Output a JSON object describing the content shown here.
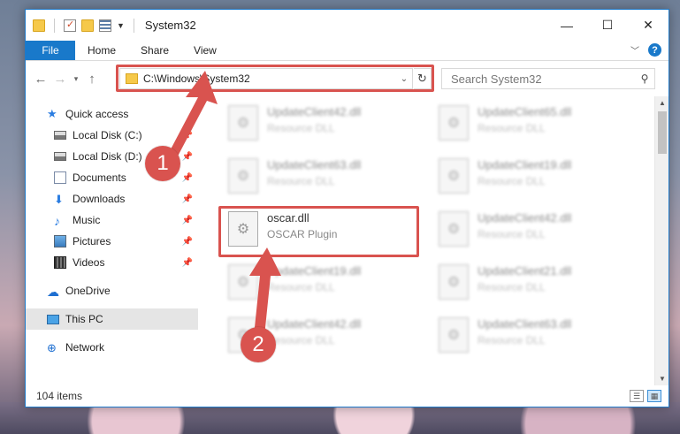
{
  "titlebar": {
    "title": "System32",
    "controls": {
      "minimize": "—",
      "maximize": "☐",
      "close": "✕"
    }
  },
  "ribbon": {
    "tabs": [
      "File",
      "Home",
      "Share",
      "View"
    ]
  },
  "nav": {
    "back": "←",
    "forward": "→",
    "recent": "▾",
    "up": "↑",
    "address": "C:\\Windows\\System32",
    "search_placeholder": "Search System32"
  },
  "sidebar": {
    "quick_access": "Quick access",
    "items": [
      {
        "label": "Local Disk (C:)",
        "icon": "drive-icon"
      },
      {
        "label": "Local Disk (D:)",
        "icon": "drive-icon"
      },
      {
        "label": "Documents",
        "icon": "documents-icon"
      },
      {
        "label": "Downloads",
        "icon": "downloads-icon"
      },
      {
        "label": "Music",
        "icon": "music-icon"
      },
      {
        "label": "Pictures",
        "icon": "pictures-icon"
      },
      {
        "label": "Videos",
        "icon": "videos-icon"
      }
    ],
    "onedrive": "OneDrive",
    "this_pc": "This PC",
    "network": "Network"
  },
  "files": {
    "left": [
      {
        "name": "UpdateClient42.dll",
        "desc": "Resource DLL"
      },
      {
        "name": "UpdateClient63.dll",
        "desc": "Resource DLL"
      },
      {
        "name": "oscar.dll",
        "desc": "OSCAR Plugin"
      },
      {
        "name": "UpdateClient19.dll",
        "desc": "Resource DLL"
      },
      {
        "name": "UpdateClient42.dll",
        "desc": "Resource DLL"
      }
    ],
    "right": [
      {
        "name": "UpdateClient65.dll",
        "desc": "Resource DLL"
      },
      {
        "name": "UpdateClient19.dll",
        "desc": "Resource DLL"
      },
      {
        "name": "UpdateClient42.dll",
        "desc": "Resource DLL"
      },
      {
        "name": "UpdateClient21.dll",
        "desc": "Resource DLL"
      },
      {
        "name": "UpdateClient63.dll",
        "desc": "Resource DLL"
      }
    ]
  },
  "status": {
    "item_count": "104 items"
  },
  "callouts": {
    "step1": "1",
    "step2": "2",
    "color": "#d9534f"
  }
}
